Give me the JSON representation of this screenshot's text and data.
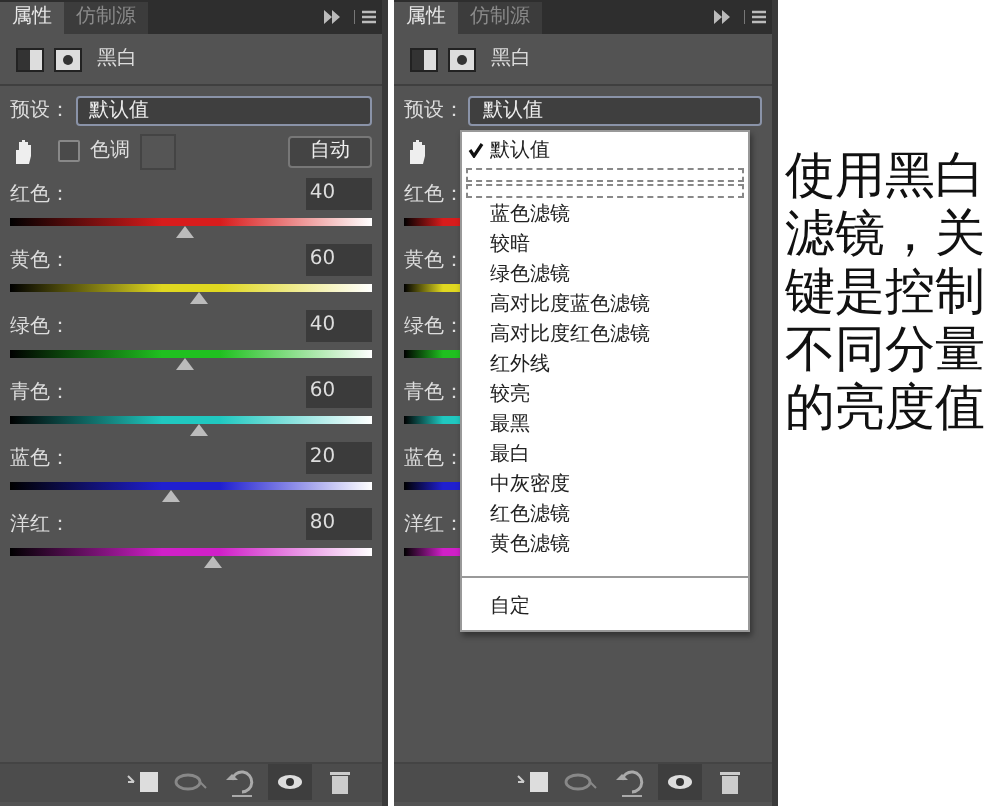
{
  "panels": [
    {
      "tabs": [
        {
          "label": "属性",
          "selected": true
        },
        {
          "label": "仿制源",
          "selected": false
        }
      ],
      "adjustment_title": "黑白",
      "preset": {
        "label": "预设：",
        "value": "默认值"
      },
      "tint": {
        "label": "色调",
        "checked": false
      },
      "auto_button": "自动",
      "sliders": [
        {
          "label": "红色：",
          "value": "40",
          "level": 0.48,
          "color": "#d81c1c"
        },
        {
          "label": "黄色：",
          "value": "60",
          "level": 0.52,
          "color": "#e0d820"
        },
        {
          "label": "绿色：",
          "value": "40",
          "level": 0.48,
          "color": "#20c020"
        },
        {
          "label": "青色：",
          "value": "60",
          "level": 0.52,
          "color": "#20c8c0"
        },
        {
          "label": "蓝色：",
          "value": "20",
          "level": 0.44,
          "color": "#2020d0"
        },
        {
          "label": "洋红：",
          "value": "80",
          "level": 0.56,
          "color": "#d020c8"
        }
      ]
    },
    {
      "tabs": [
        {
          "label": "属性",
          "selected": true
        },
        {
          "label": "仿制源",
          "selected": false
        }
      ],
      "adjustment_title": "黑白",
      "preset": {
        "label": "预设：",
        "value": "默认值"
      },
      "sliders": [
        {
          "label": "红色：",
          "color": "#d81c1c"
        },
        {
          "label": "黄色：",
          "color": "#e0d820"
        },
        {
          "label": "绿色：",
          "color": "#20c020"
        },
        {
          "label": "青色：",
          "color": "#20c8c0"
        },
        {
          "label": "蓝色：",
          "color": "#2020d0"
        },
        {
          "label": "洋红：",
          "color": "#d020c8"
        }
      ],
      "menu": {
        "items": [
          {
            "kind": "item",
            "label": "默认值",
            "checked": true
          },
          {
            "kind": "blank"
          },
          {
            "kind": "blank"
          },
          {
            "kind": "item",
            "label": "蓝色滤镜",
            "checked": false
          },
          {
            "kind": "item",
            "label": "较暗",
            "checked": false
          },
          {
            "kind": "item",
            "label": "绿色滤镜",
            "checked": false
          },
          {
            "kind": "item",
            "label": "高对比度蓝色滤镜",
            "checked": false
          },
          {
            "kind": "item",
            "label": "高对比度红色滤镜",
            "checked": false
          },
          {
            "kind": "item",
            "label": "红外线",
            "checked": false
          },
          {
            "kind": "item",
            "label": "较亮",
            "checked": false
          },
          {
            "kind": "item",
            "label": "最黑",
            "checked": false
          },
          {
            "kind": "item",
            "label": "最白",
            "checked": false
          },
          {
            "kind": "item",
            "label": "中灰密度",
            "checked": false
          },
          {
            "kind": "item",
            "label": "红色滤镜",
            "checked": false
          },
          {
            "kind": "item",
            "label": "黄色滤镜",
            "checked": false
          },
          {
            "kind": "separator"
          },
          {
            "kind": "item",
            "label": "自定",
            "checked": false
          }
        ]
      }
    }
  ],
  "annotation": "使用黑白滤镜，关键是控制不同分量的亮度值"
}
